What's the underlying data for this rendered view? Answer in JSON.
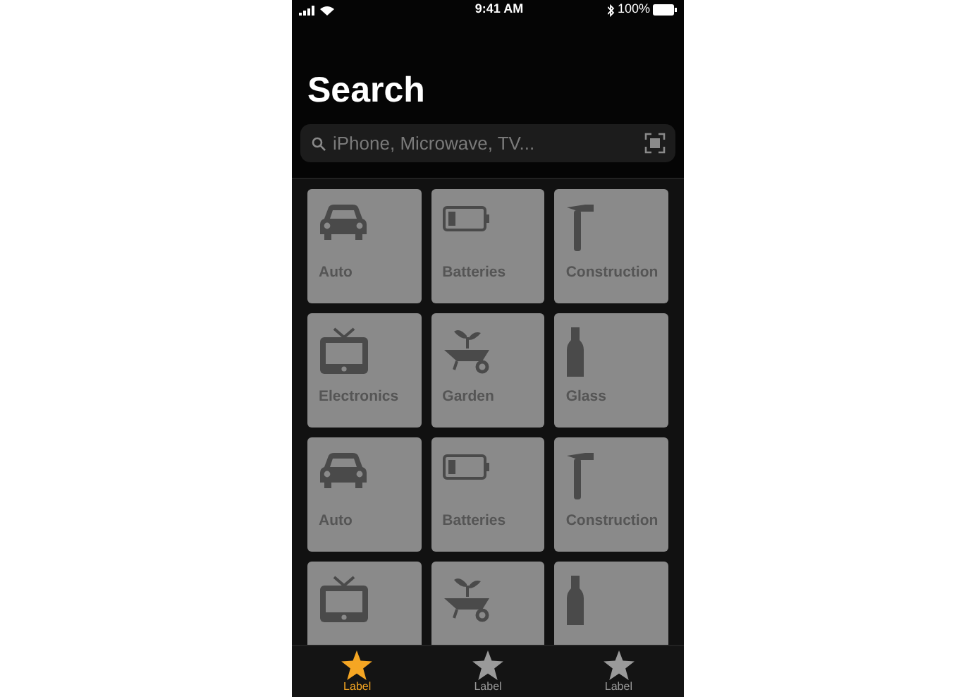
{
  "status_bar": {
    "time": "9:41 AM",
    "battery": "100%"
  },
  "title": "Search",
  "search": {
    "placeholder": "iPhone, Microwave, TV..."
  },
  "tiles": [
    {
      "kind": "car",
      "label": "Auto"
    },
    {
      "kind": "battery",
      "label": "Batteries"
    },
    {
      "kind": "hammer",
      "label": "Construction"
    },
    {
      "kind": "tv",
      "label": "Electronics"
    },
    {
      "kind": "garden",
      "label": "Garden"
    },
    {
      "kind": "bottle",
      "label": "Glass"
    },
    {
      "kind": "car",
      "label": "Auto"
    },
    {
      "kind": "battery",
      "label": "Batteries"
    },
    {
      "kind": "hammer",
      "label": "Construction"
    },
    {
      "kind": "tv"
    },
    {
      "kind": "garden"
    },
    {
      "kind": "bottle"
    }
  ],
  "tab_bar": [
    {
      "label": "Label",
      "selected": true
    },
    {
      "label": "Label",
      "selected": false
    },
    {
      "label": "Label",
      "selected": false
    }
  ]
}
